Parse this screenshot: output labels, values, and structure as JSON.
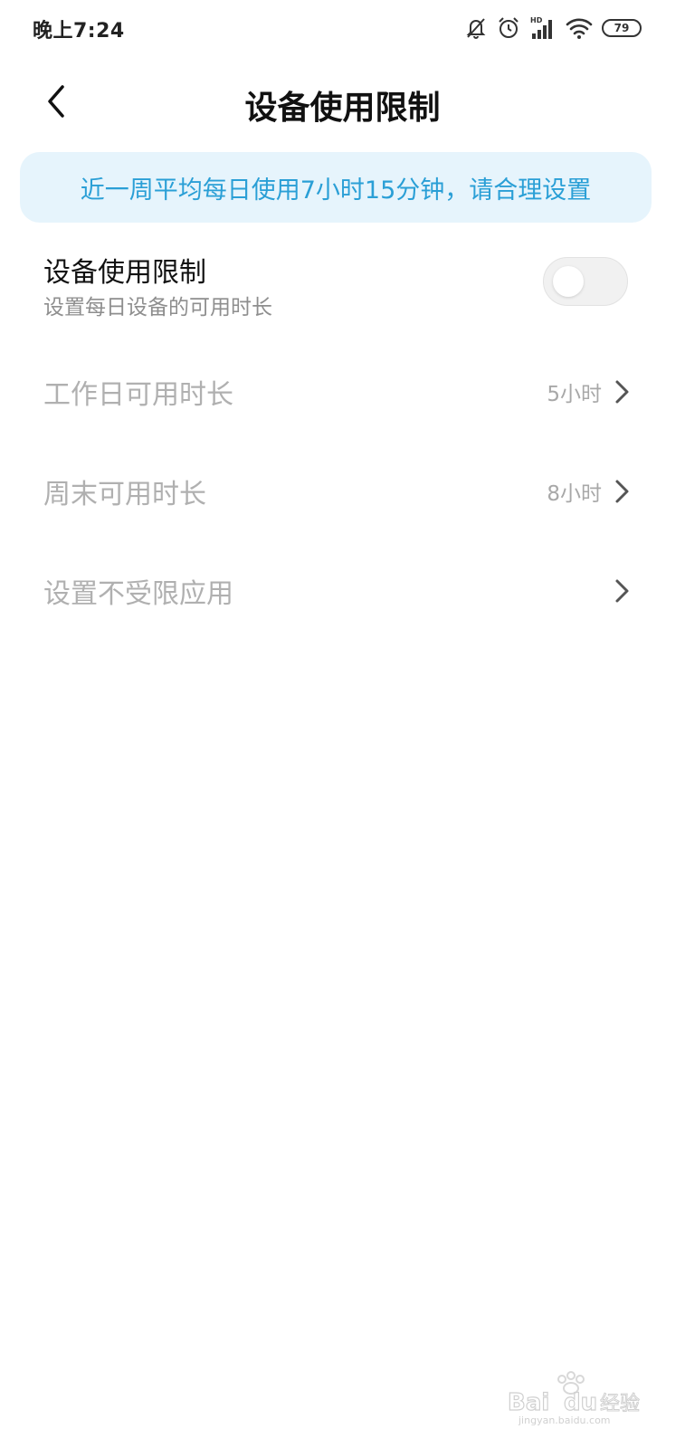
{
  "status_bar": {
    "time": "晚上7:24",
    "network_label": "HD",
    "battery_level": "79",
    "icons": [
      "notifications-off-icon",
      "alarm-icon",
      "signal-icon",
      "wifi-icon",
      "battery-icon"
    ]
  },
  "header": {
    "title": "设备使用限制",
    "back_icon": "chevron-left-icon"
  },
  "banner": {
    "text": "近一周平均每日使用7小时15分钟，请合理设置",
    "color": "#2a9fd6",
    "background": "#e6f4fc"
  },
  "setting_main": {
    "title": "设备使用限制",
    "subtitle": "设置每日设备的可用时长",
    "toggle_on": false
  },
  "rows": [
    {
      "label": "工作日可用时长",
      "value": "5小时"
    },
    {
      "label": "周末可用时长",
      "value": "8小时"
    },
    {
      "label": "设置不受限应用",
      "value": ""
    }
  ],
  "watermark": {
    "brand": "Baidu经验",
    "url": "jingyan.baidu.com"
  }
}
